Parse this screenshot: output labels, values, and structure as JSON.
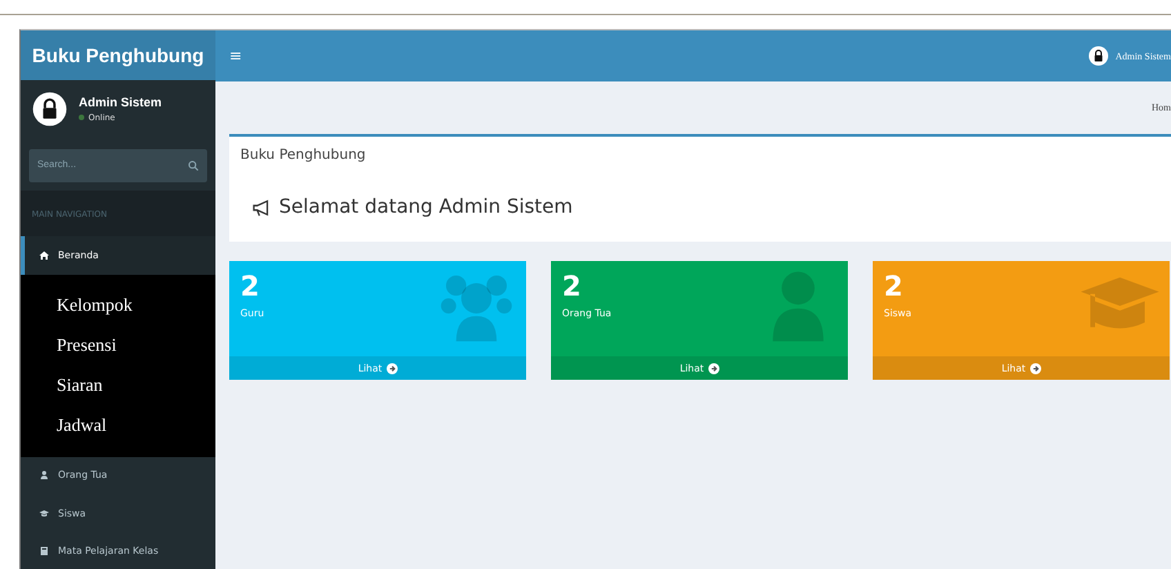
{
  "brand": "Buku Penghubung",
  "header": {
    "menu_glyph": "≡",
    "user": "Admin Sistem"
  },
  "sidebar": {
    "user": {
      "name": "Admin Sistem",
      "status": "Online"
    },
    "search": {
      "placeholder": "Search..."
    },
    "nav_header": "MAIN NAVIGATION",
    "items": [
      {
        "label": "Beranda",
        "kind": "home",
        "selected": true
      }
    ],
    "submenu": [
      "Kelompok",
      "Presensi",
      "Siaran",
      "Jadwal"
    ],
    "items_after": [
      {
        "label": "Orang Tua",
        "kind": "user",
        "selected": false
      },
      {
        "label": "Siswa",
        "kind": "cap",
        "selected": false
      },
      {
        "label": "Mata Pelajaran Kelas",
        "kind": "book",
        "selected": false
      }
    ]
  },
  "breadcrumb": "Hom",
  "box": {
    "title": "Buku Penghubung",
    "welcome": "Selamat datang Admin Sistem"
  },
  "cards": [
    {
      "count": "2",
      "label": "Guru",
      "link": "Lihat",
      "color": "#00c0ef",
      "kind": "users"
    },
    {
      "count": "2",
      "label": "Orang Tua",
      "link": "Lihat",
      "color": "#00a65a",
      "kind": "user"
    },
    {
      "count": "2",
      "label": "Siswa",
      "link": "Lihat",
      "color": "#f39c12",
      "kind": "cap"
    }
  ]
}
